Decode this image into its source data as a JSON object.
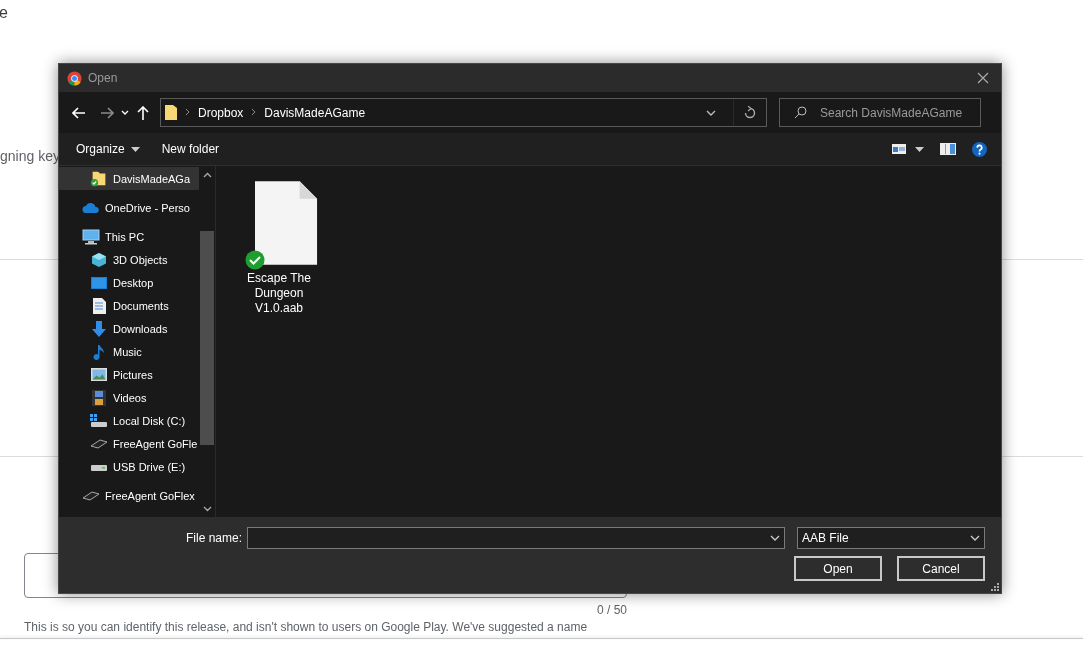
{
  "page": {
    "heading_fragment": "e",
    "label_fragment": "gning key",
    "release_name": {
      "counter": "0 / 50"
    },
    "help_text": "This is so you can identify this release, and isn't shown to users on Google Play. We've suggested a name"
  },
  "dialog": {
    "title": "Open",
    "breadcrumbs": [
      "Dropbox",
      "DavisMadeAGame"
    ],
    "search": {
      "placeholder": "Search DavisMadeAGame"
    },
    "commands": [
      {
        "label": "Organize",
        "dropdown": true
      },
      {
        "label": "New folder",
        "dropdown": false
      }
    ],
    "nav_pane": [
      {
        "label": "DavisMadeAGa",
        "kind": "synced-folder",
        "selected": true
      },
      {
        "label": "OneDrive - Perso",
        "kind": "cloud",
        "selected": false
      },
      {
        "label": "This PC",
        "kind": "computer",
        "selected": false,
        "children": [
          {
            "label": "3D Objects",
            "kind": "cube",
            "selected": false
          },
          {
            "label": "Desktop",
            "kind": "desktop",
            "selected": false
          },
          {
            "label": "Documents",
            "kind": "document",
            "selected": false
          },
          {
            "label": "Downloads",
            "kind": "download",
            "selected": false
          },
          {
            "label": "Music",
            "kind": "music",
            "selected": false
          },
          {
            "label": "Pictures",
            "kind": "pictures",
            "selected": false
          },
          {
            "label": "Videos",
            "kind": "video",
            "selected": false
          },
          {
            "label": "Local Disk (C:)",
            "kind": "disk",
            "selected": false
          },
          {
            "label": "FreeAgent GoFle",
            "kind": "portable-drive",
            "selected": false
          },
          {
            "label": "USB Drive (E:)",
            "kind": "drive",
            "selected": false
          }
        ]
      },
      {
        "label": "FreeAgent GoFlex",
        "kind": "portable-drive",
        "selected": false
      }
    ],
    "files": [
      {
        "name": "Escape The Dungeon V1.0.aab",
        "synced": true
      }
    ],
    "file_name_label": "File name:",
    "file_type": "AAB File",
    "buttons": [
      "Open",
      "Cancel"
    ]
  }
}
